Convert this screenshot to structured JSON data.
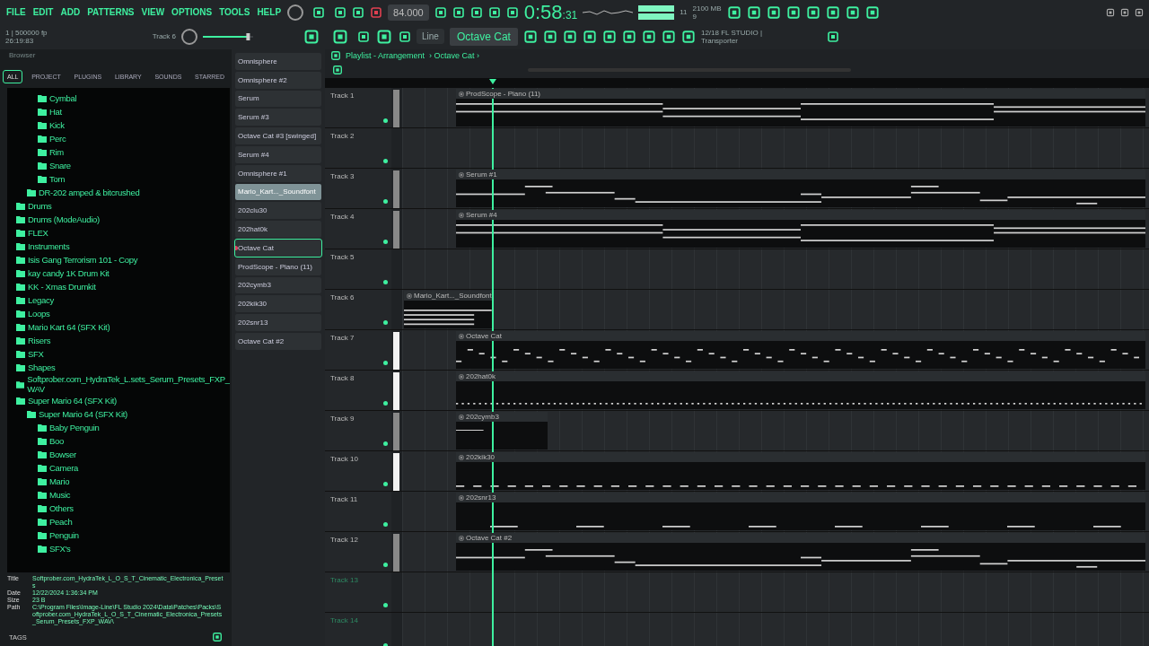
{
  "menu": [
    "FILE",
    "EDIT",
    "ADD",
    "PATTERNS",
    "VIEW",
    "OPTIONS",
    "TOOLS",
    "HELP"
  ],
  "transport": {
    "tempo": "84.000",
    "time_main": "0:58",
    "time_sub": ":31",
    "hint_line_1": "1 | 500000 fp",
    "hint_line_2": "26:19:83",
    "focus": "Track 6",
    "master": {
      "level": 0.9
    },
    "snap": "Line",
    "pattern": "Octave Cat",
    "cpu": "11",
    "memory": "2100 MB",
    "voices": "9",
    "news": "12/18 FL STUDIO |",
    "news_sub": "Transporter"
  },
  "browser": {
    "title": "Browser",
    "tabs": [
      {
        "label": "ALL",
        "selected": true
      },
      {
        "label": "PROJECT",
        "selected": false
      },
      {
        "label": "PLUGINS",
        "selected": false
      },
      {
        "label": "LIBRARY",
        "selected": false
      },
      {
        "label": "SOUNDS",
        "selected": false
      },
      {
        "label": "STARRED",
        "selected": false
      }
    ],
    "tree": [
      {
        "children": [
          {
            "children": [
              {
                "label": "Cymbal"
              },
              {
                "label": "Hat"
              },
              {
                "label": "Kick"
              },
              {
                "label": "Perc"
              },
              {
                "label": "Rim"
              },
              {
                "label": "Snare"
              },
              {
                "label": "Tom"
              }
            ]
          },
          {
            "label": "DR-202 amped & bitcrushed"
          }
        ]
      },
      {
        "label": "Drums"
      },
      {
        "label": "Drums (ModeAudio)"
      },
      {
        "label": "FLEX"
      },
      {
        "label": "Instruments"
      },
      {
        "label": "Isis Gang Terrorism 101 - Copy"
      },
      {
        "label": "kay candy 1K Drum Kit"
      },
      {
        "label": "KK - Xmas Drumkit"
      },
      {
        "label": "Legacy"
      },
      {
        "label": "Loops"
      },
      {
        "label": "Mario Kart 64 (SFX Kit)"
      },
      {
        "label": "Risers"
      },
      {
        "label": "SFX"
      },
      {
        "label": "Shapes"
      },
      {
        "label": "Softprober.com_HydraTek_L.sets_Serum_Presets_FXP_WAV"
      },
      {
        "label": "Super Mario 64 (SFX Kit)",
        "children": [
          {
            "label": "Super Mario 64 (SFX Kit)",
            "children": [
              {
                "label": "Baby Penguin"
              },
              {
                "label": "Boo"
              },
              {
                "label": "Bowser"
              },
              {
                "label": "Camera"
              },
              {
                "label": "Mario"
              },
              {
                "label": "Music"
              },
              {
                "label": "Others"
              },
              {
                "label": "Peach"
              },
              {
                "label": "Penguin"
              },
              {
                "label": "SFX's"
              }
            ]
          }
        ]
      }
    ],
    "info": [
      {
        "key": "Title",
        "value": "Softprober.com_HydraTek_L_O_S_T_Cinematic_Electronica_Presets"
      },
      {
        "key": "Date",
        "value": "12/22/2024 1:36:34 PM"
      },
      {
        "key": "Size",
        "value": "23 B"
      },
      {
        "key": "Path",
        "value": "C:\\Program Files\\Image-Line\\FL Studio 2024\\Data\\Patches\\Packs\\Softprober.com_HydraTek_L_O_S_T_Cinematic_Electronica_Presets_Serum_Presets_FXP_WAV\\"
      }
    ],
    "tags_label": "TAGS"
  },
  "patterns": [
    {
      "name": "Omnisphere",
      "selected": false,
      "current": false
    },
    {
      "name": "Omnisphere #2",
      "selected": false,
      "current": false
    },
    {
      "name": "Serum",
      "selected": false,
      "current": false
    },
    {
      "name": "Serum #3",
      "selected": false,
      "current": false
    },
    {
      "name": "Octave Cat #3 [swinged]",
      "selected": false,
      "current": false
    },
    {
      "name": "Serum #4",
      "selected": false,
      "current": false
    },
    {
      "name": "Omnisphere #1",
      "selected": false,
      "current": false
    },
    {
      "name": "Mario_Kart..._Soundfont",
      "selected": true,
      "current": false
    },
    {
      "name": "202clu30",
      "selected": false,
      "current": false
    },
    {
      "name": "202hat0k",
      "selected": false,
      "current": false
    },
    {
      "name": "Octave Cat",
      "selected": false,
      "current": true
    },
    {
      "name": "ProdScope - Piano (11)",
      "selected": false,
      "current": false
    },
    {
      "name": "202cymb3",
      "selected": false,
      "current": false
    },
    {
      "name": "202kik30",
      "selected": false,
      "current": false
    },
    {
      "name": "202snr13",
      "selected": false,
      "current": false
    },
    {
      "name": "Octave Cat #2",
      "selected": false,
      "current": false
    }
  ],
  "playlist": {
    "title": "Playlist - Arrangement",
    "crumb": "› Octave Cat ›",
    "tracks": [
      {
        "name": "Track 1",
        "active": true,
        "marker": {
          "kind": "dim"
        },
        "clips": [
          {
            "label": "ProdScope - Piano (11)",
            "kind": "chords"
          }
        ]
      },
      {
        "name": "Track 2",
        "active": true
      },
      {
        "name": "Track 3",
        "active": true,
        "marker": {
          "kind": "dim"
        },
        "clips": [
          {
            "label": "Serum #1",
            "kind": "melody"
          }
        ]
      },
      {
        "name": "Track 4",
        "active": true,
        "marker": {
          "kind": "dim"
        },
        "clips": [
          {
            "label": "Serum #4",
            "kind": "chords"
          }
        ]
      },
      {
        "name": "Track 5",
        "active": true
      },
      {
        "name": "Track 6",
        "active": true,
        "clips": [
          {
            "label": "Mario_Kart..._Soundfont",
            "kind": "stack"
          }
        ]
      },
      {
        "name": "Track 7",
        "active": true,
        "marker": {
          "kind": "bright"
        },
        "clips": [
          {
            "label": "Octave Cat",
            "kind": "steps"
          }
        ]
      },
      {
        "name": "Track 8",
        "active": true,
        "marker": {
          "kind": "bright"
        },
        "clips": [
          {
            "label": "202hat0k",
            "kind": "dots"
          }
        ]
      },
      {
        "name": "Track 9",
        "active": true,
        "marker": {
          "kind": "dim"
        },
        "clips": [
          {
            "label": "202cymb3",
            "kind": "single"
          }
        ]
      },
      {
        "name": "Track 10",
        "active": true,
        "marker": {
          "kind": "bright"
        },
        "clips": [
          {
            "label": "202kik30",
            "kind": "beats"
          }
        ]
      },
      {
        "name": "Track 11",
        "active": true,
        "clips": [
          {
            "label": "202snr13",
            "kind": "sparse"
          }
        ]
      },
      {
        "name": "Track 12",
        "active": true,
        "marker": {
          "kind": "dim"
        },
        "clips": [
          {
            "label": "Octave Cat #2",
            "kind": "melody"
          }
        ]
      },
      {
        "name": "Track 13",
        "active": false
      },
      {
        "name": "Track 14",
        "active": false
      }
    ]
  }
}
